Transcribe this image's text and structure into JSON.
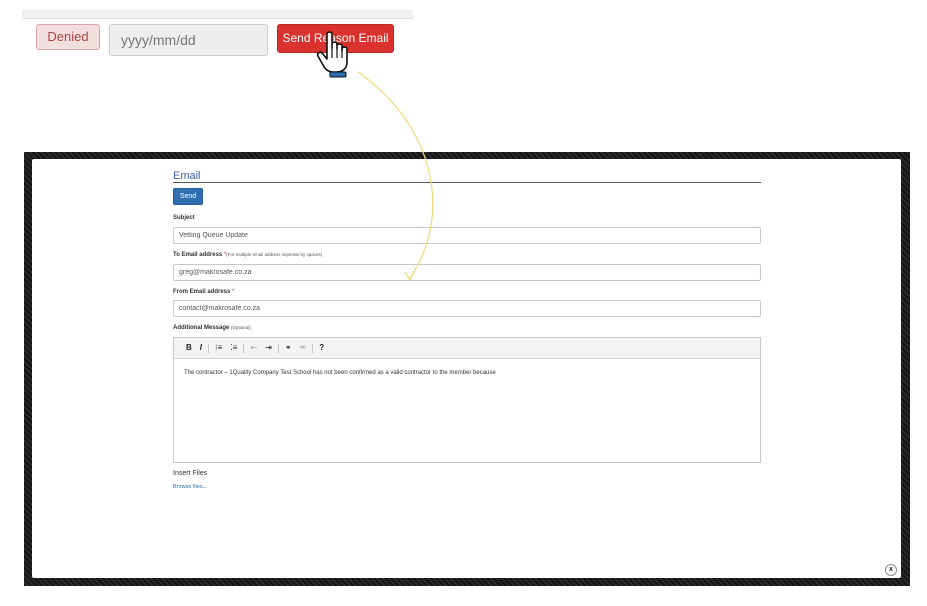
{
  "top_bar": {
    "denied_label": "Denied",
    "date_placeholder": "yyyy/mm/dd",
    "send_reason_label": "Send Reason Email"
  },
  "modal": {
    "title": "Email",
    "send_label": "Send",
    "subject": {
      "label": "Subject",
      "value": "Vetting Queue Update"
    },
    "to": {
      "label": "To Email address",
      "required": "*",
      "note": "(For multiple email address seperate by spaces)",
      "value": "greg@makrosafe.co.za"
    },
    "from": {
      "label": "From Email address",
      "required": "*",
      "value": "contact@makrosafe.co.za"
    },
    "message": {
      "label": "Additional Message",
      "note": "(Optional)",
      "toolbar": {
        "bold": "B",
        "italic": "I",
        "ordered_list": "⁝≡",
        "unordered_list": "⁚≡",
        "outdent": "⇤",
        "indent": "⇥",
        "link": "⚭",
        "unlink": "⚮",
        "help": "?"
      },
      "body": "The contractor – 1Quality Company Test School has not been confirmed as a valid contractor to the member because"
    },
    "insert_files_label": "Insert Files",
    "browse_label": "Browse files...",
    "close_label": "x"
  }
}
